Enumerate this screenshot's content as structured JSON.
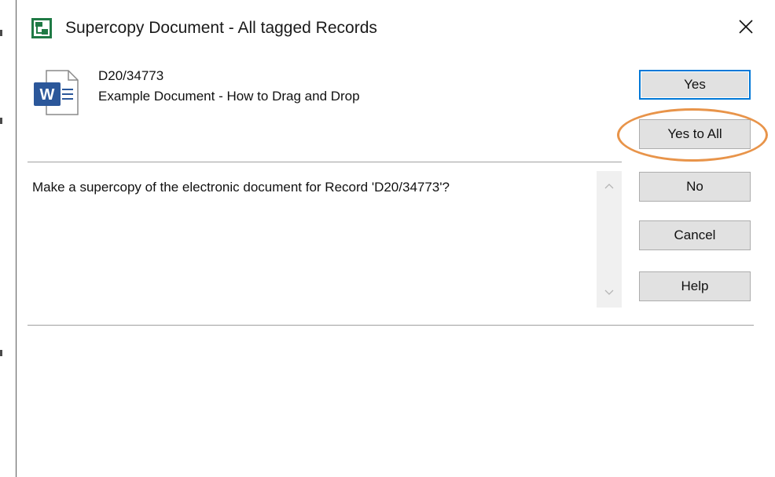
{
  "window": {
    "title": "Supercopy Document - All tagged Records",
    "app_icon": "app-icon",
    "close_icon": "close-icon"
  },
  "record": {
    "number": "D20/34773",
    "title": "Example Document - How to Drag and Drop",
    "file_icon": "word-document-icon"
  },
  "message": "Make a supercopy of the electronic document for Record 'D20/34773'?",
  "buttons": {
    "yes": "Yes",
    "yes_to_all": "Yes to All",
    "no": "No",
    "cancel": "Cancel",
    "help": "Help"
  },
  "colors": {
    "default_button_border": "#0078d7",
    "highlight_ring": "#e8944a",
    "app_icon_green": "#1f7a45",
    "word_blue": "#2b579a"
  }
}
